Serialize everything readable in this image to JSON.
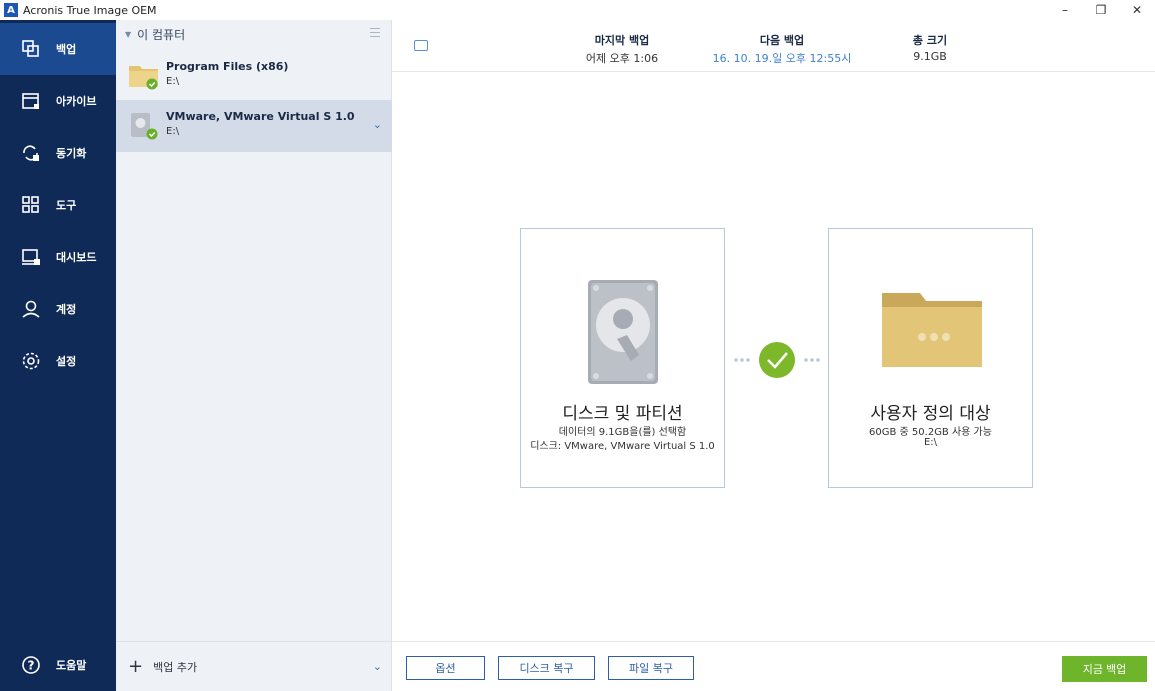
{
  "window": {
    "title": "Acronis True Image OEM",
    "logo_letter": "A",
    "minimize": "–",
    "restore": "❐",
    "close": "✕"
  },
  "sidebar": {
    "items": [
      {
        "label": "백업",
        "icon": "backup-icon",
        "active": true
      },
      {
        "label": "아카이브",
        "icon": "archive-icon"
      },
      {
        "label": "동기화",
        "icon": "sync-icon"
      },
      {
        "label": "도구",
        "icon": "tools-icon"
      },
      {
        "label": "대시보드",
        "icon": "dashboard-icon"
      },
      {
        "label": "계정",
        "icon": "account-icon"
      },
      {
        "label": "설정",
        "icon": "settings-icon"
      }
    ],
    "help": {
      "label": "도움말",
      "icon": "help-icon"
    }
  },
  "backup_list": {
    "header": "이 컴퓨터",
    "items": [
      {
        "name": "Program Files (x86)",
        "sub": "E:\\",
        "icon": "folder-icon"
      },
      {
        "name": "VMware, VMware Virtual S 1.0",
        "sub": "E:\\",
        "icon": "disk-icon",
        "selected": true
      }
    ],
    "add_label": "백업 추가"
  },
  "summary": {
    "last_backup": {
      "label": "마지막 백업",
      "value": "어제 오후 1:06"
    },
    "next_backup": {
      "label": "다음 백업",
      "value": "16. 10. 19.일 오후 12:55시"
    },
    "total_size": {
      "label": "총 크기",
      "value": "9.1GB"
    }
  },
  "source_card": {
    "title": "디스크 및 파티션",
    "line1": "데이터의 9.1GB을(를) 선택함",
    "line2": "디스크: VMware, VMware Virtual S 1.0"
  },
  "dest_card": {
    "title": "사용자 정의 대상",
    "line1": "60GB 중 50.2GB 사용 가능",
    "line2": "E:\\"
  },
  "buttons": {
    "options": "옵션",
    "disk_recovery": "디스크 복구",
    "file_recovery": "파일 복구",
    "backup_now": "지금 백업"
  },
  "colors": {
    "sidebar": "#0f2a57",
    "sidebar_active": "#1c4a91",
    "accent_green": "#6fb52c",
    "link_blue": "#3f7fd0"
  }
}
